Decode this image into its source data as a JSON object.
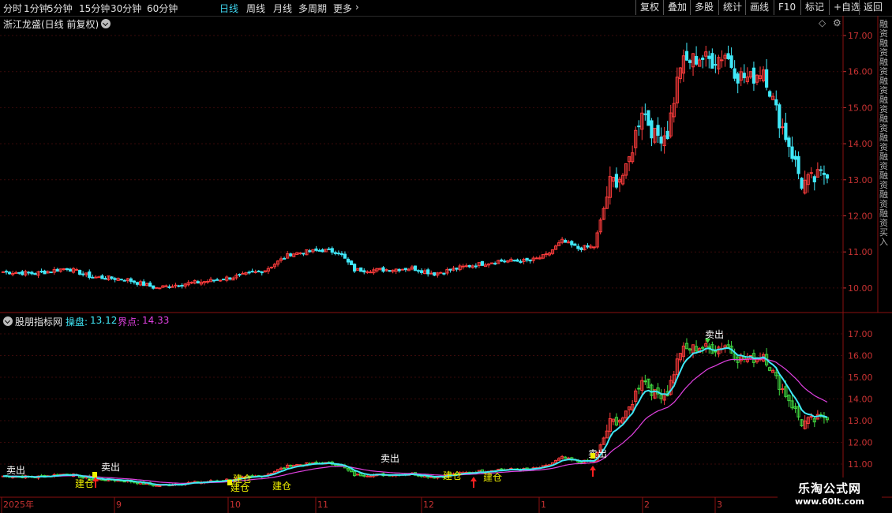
{
  "toolbar": {
    "timeframes": [
      "分时",
      "1分钟",
      "5分钟",
      "15分钟",
      "30分钟",
      "60分钟",
      "日线",
      "周线",
      "月线",
      "多周期",
      "更多"
    ],
    "active_timeframe": "日线",
    "right_buttons": [
      "复权",
      "叠加",
      "多股",
      "统计",
      "画线",
      "F10",
      "标记",
      "+自选",
      "返回"
    ]
  },
  "main_chart": {
    "title": "浙江龙盛(日线 前复权)",
    "price_ticks": [
      "17.00",
      "16.00",
      "15.00",
      "14.00",
      "13.00",
      "12.00",
      "11.00",
      "10.00"
    ],
    "right_edge_text": "融资融资融资融资融资融资融资融资融资融资融资买入"
  },
  "indicator": {
    "name": "股朋指标网",
    "line1_label": "操盘:",
    "line1_value": "13.12",
    "line2_label": "界点:",
    "line2_value": "14.33",
    "price_ticks": [
      "17.00",
      "16.00",
      "15.00",
      "14.00",
      "13.00",
      "12.00",
      "11.00"
    ],
    "signals": [
      "卖出",
      "卖出",
      "卖出",
      "卖出",
      "建仓",
      "建仓",
      "建仓",
      "建仓",
      "建仓",
      "建仓"
    ]
  },
  "x_axis": {
    "labels": [
      "2025年",
      "9",
      "10",
      "11",
      "12",
      "1",
      "2",
      "3"
    ]
  },
  "colors": {
    "up": "#ff3c3c",
    "down": "#40e8f8",
    "line1": "#40e8f8",
    "line2": "#e040e0",
    "axis_red": "#8a1010"
  },
  "watermark": {
    "line1": "乐淘公式网",
    "line2": "www.60lt.com"
  }
}
